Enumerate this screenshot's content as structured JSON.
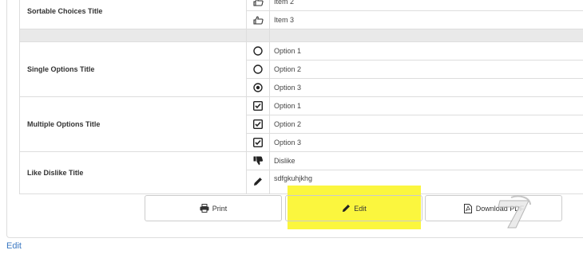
{
  "questions": {
    "sortable": {
      "title": "Sortable Choices Title",
      "items": [
        "Item 2",
        "Item 3"
      ]
    },
    "single": {
      "title": "Single Options Title",
      "options": [
        "Option 1",
        "Option 2",
        "Option 3"
      ],
      "selected_index": 2
    },
    "multiple": {
      "title": "Multiple Options Title",
      "options": [
        "Option 1",
        "Option 2",
        "Option 3"
      ],
      "checked": [
        true,
        true,
        true
      ]
    },
    "like_dislike": {
      "title": "Like Dislike Title",
      "value": "Dislike",
      "comment": "sdfgkuhjkhg"
    }
  },
  "buttons": {
    "print": "Print",
    "edit": "Edit",
    "download": "Download PDF"
  },
  "footer": {
    "edit_link": "Edit"
  },
  "icons": {
    "sortable": "hand-pointer-icon",
    "radio": "radio-icon",
    "checkbox": "checkbox-icon",
    "dislike": "thumbs-down-icon",
    "comment": "pencil-icon",
    "print": "print-icon",
    "edit": "pencil-icon",
    "download": "pdf-file-icon"
  },
  "colors": {
    "highlight": "#fbf63e",
    "link": "#3a78c2"
  }
}
